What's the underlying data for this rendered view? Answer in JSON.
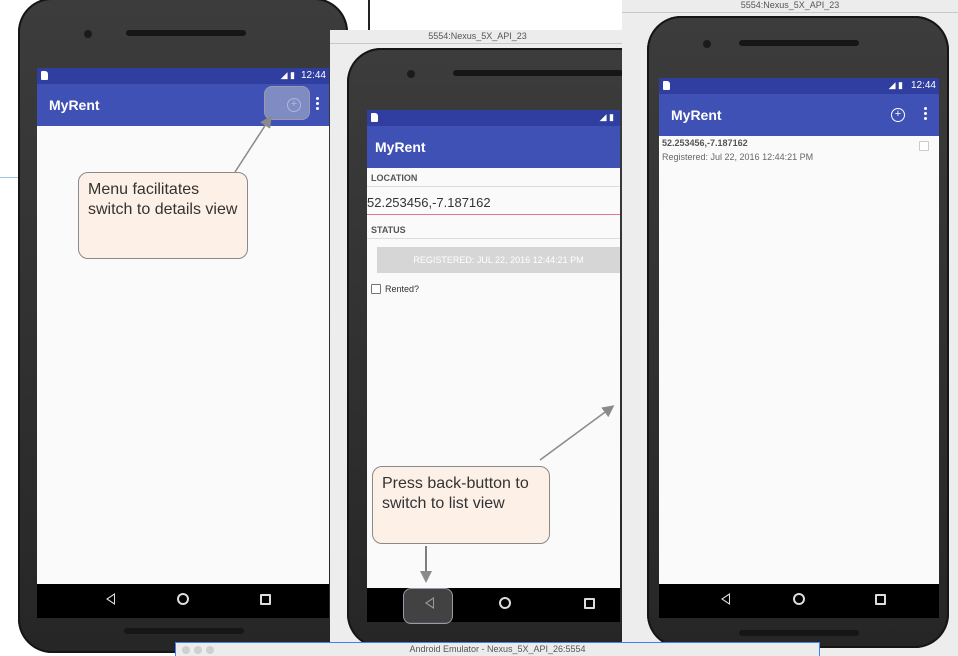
{
  "phone1": {
    "status_time": "12:44",
    "app_title": "MyRent",
    "add_icon": "add-circle-icon",
    "more_icon": "overflow-menu-icon"
  },
  "phone2": {
    "window_title": "5554:Nexus_5X_API_23",
    "app_title": "MyRent",
    "location_label": "LOCATION",
    "location_value": "52.253456,-7.187162",
    "status_label": "STATUS",
    "registered_button": "REGISTERED: JUL 22, 2016 12:44:21 PM",
    "rented_label": "Rented?"
  },
  "phone3": {
    "window_title": "5554:Nexus_5X_API_23",
    "status_time": "12:44",
    "app_title": "MyRent",
    "list_item": {
      "title": "52.253456,-7.187162",
      "subtitle": "Registered: Jul 22, 2016 12:44:21 PM"
    }
  },
  "callouts": {
    "menu": "Menu facilitates switch to details view",
    "back": "Press back-button to switch to list view"
  },
  "bottom_window": {
    "title": "Android Emulator - Nexus_5X_API_26:5554"
  },
  "colors": {
    "primary": "#3f51b5",
    "primary_dark": "#303f9f",
    "accent": "#e57399",
    "callout_bg": "#fdf0e6"
  }
}
